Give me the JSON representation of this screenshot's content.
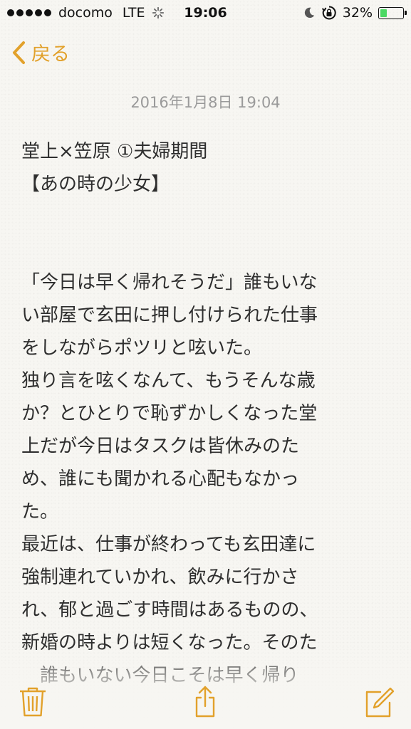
{
  "status_bar": {
    "carrier": "docomo",
    "network": "LTE",
    "time": "19:06",
    "battery": "32%",
    "battery_level": 0.32,
    "battery_color": "#4cd964"
  },
  "nav": {
    "back_label": "戻る",
    "accent_color": "#e2a12b"
  },
  "note": {
    "date": "2016年1月8日 19:04",
    "lines": [
      "堂上×笠原 ①夫婦期間",
      "【あの時の少女】",
      "",
      "",
      "「今日は早く帰れそうだ」誰もいな",
      "い部屋で玄田に押し付けられた仕事",
      "をしながらポツリと呟いた。",
      "独り言を呟くなんて、もうそんな歳",
      "か？とひとりで恥ずかしくなった堂",
      "上だが今日はタスクは皆休みのた",
      "め、誰にも聞かれる心配もなかっ",
      "た。",
      "最近は、仕事が終わっても玄田達に",
      "強制連れていかれ、飲みに行かさ",
      "れ、郁と過ごす時間はあるものの、",
      "新婚の時よりは短くなった。そのた",
      "　誰もいない今日こそは早く帰り"
    ]
  },
  "toolbar": {
    "trash_icon": "trash-icon",
    "share_icon": "share-icon",
    "compose_icon": "compose-icon"
  }
}
